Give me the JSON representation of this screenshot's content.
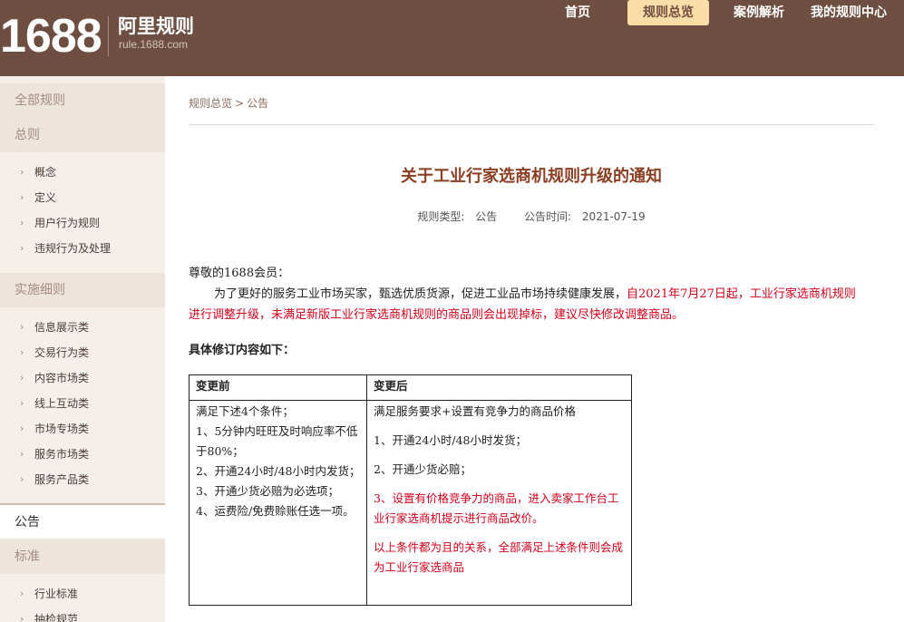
{
  "header": {
    "logo_number": "1688",
    "logo_title": "阿里规则",
    "logo_url": "rule.1688.com",
    "nav": [
      {
        "label": "首页",
        "active": false
      },
      {
        "label": "规则总览",
        "active": true
      },
      {
        "label": "案例解析",
        "active": false
      },
      {
        "label": "我的规则中心",
        "active": false
      }
    ]
  },
  "sidebar": {
    "all_rules": "全部规则",
    "general": "总则",
    "general_items": [
      "概念",
      "定义",
      "用户行为规则",
      "违规行为及处理"
    ],
    "implementation": "实施细则",
    "implementation_items": [
      "信息展示类",
      "交易行为类",
      "内容市场类",
      "线上互动类",
      "市场专场类",
      "服务市场类",
      "服务产品类"
    ],
    "announcement": "公告",
    "standards": "标准",
    "standards_items": [
      "行业标准",
      "抽检规范"
    ]
  },
  "breadcrumb": {
    "root": "规则总览",
    "separator": ">",
    "current": "公告"
  },
  "article": {
    "title": "关于工业行家选商机规则升级的通知",
    "type_label": "规则类型:",
    "type_value": "公告",
    "time_label": "公告时间:",
    "time_value": "2021-07-19",
    "greeting": "尊敬的1688会员：",
    "intro_normal": "为了更好的服务工业市场买家，甄选优质货源，促进工业品市场持续健康发展，",
    "intro_red": "自2021年7月27日起，工业行家选商机规则进行调整升级，未满足新版工业行家选商机规则的商品则会出现掉标，建议尽快修改调整商品。",
    "details_heading": "具体修订内容如下："
  },
  "table": {
    "header_before": "变更前",
    "header_after": "变更后",
    "before_lines": [
      "满足下述4个条件；",
      "1、5分钟内旺旺及时响应率不低于80%；",
      "2、开通24小时/48小时内发货；",
      "3、开通少货必赔为必选项；",
      "4、运费险/免费赊账任选一项。"
    ],
    "after_intro": "满足服务要求+设置有竞争力的商品价格",
    "after_1": "1、开通24小时/48小时发货；",
    "after_2": "2、开通少货必赔；",
    "after_3": "3、设置有价格竞争力的商品，进入卖家工作台工业行家选商机提示进行商品改价。",
    "after_note": "以上条件都为且的关系，全部满足上述条件则会成为工业行家选商品"
  },
  "colors": {
    "header_bg": "#6e4e41",
    "nav_active_bg": "#fbdda8",
    "title_color": "#8a3e22",
    "highlight_red": "#d0021b",
    "sidebar_bg": "#f4efe9"
  }
}
